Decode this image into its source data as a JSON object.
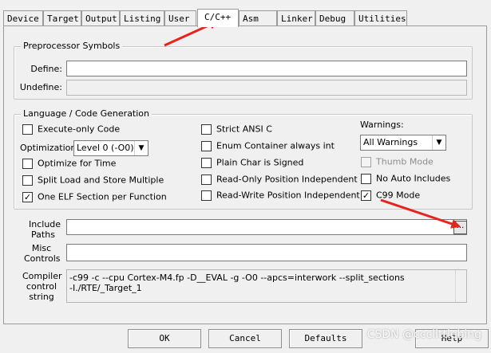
{
  "tabs": [
    {
      "label": "Device"
    },
    {
      "label": "Target"
    },
    {
      "label": "Output"
    },
    {
      "label": "Listing"
    },
    {
      "label": "User"
    },
    {
      "label": "C/C++",
      "active": true
    },
    {
      "label": "Asm"
    },
    {
      "label": "Linker"
    },
    {
      "label": "Debug"
    },
    {
      "label": "Utilities"
    }
  ],
  "preprocessor": {
    "title": "Preprocessor Symbols",
    "define_label": "Define:",
    "define_value": "",
    "undefine_label": "Undefine:",
    "undefine_value": ""
  },
  "language": {
    "title": "Language / Code Generation",
    "execute_only": {
      "label": "Execute-only Code",
      "checked": false
    },
    "optimization_label": "Optimization:",
    "optimization_value": "Level 0 (-O0)",
    "optimize_time": {
      "label": "Optimize for Time",
      "checked": false
    },
    "split_load": {
      "label": "Split Load and Store Multiple",
      "checked": false
    },
    "one_elf": {
      "label": "One ELF Section per Function",
      "checked": true
    },
    "strict_ansi": {
      "label": "Strict ANSI C",
      "checked": false
    },
    "enum_container": {
      "label": "Enum Container always int",
      "checked": false
    },
    "plain_char": {
      "label": "Plain Char is Signed",
      "checked": false
    },
    "ro_pi": {
      "label": "Read-Only Position Independent",
      "checked": false
    },
    "rw_pi": {
      "label": "Read-Write Position Independent",
      "checked": false
    },
    "warnings_label": "Warnings:",
    "warnings_value": "All Warnings",
    "thumb_mode": {
      "label": "Thumb Mode",
      "checked": false,
      "disabled": true
    },
    "no_auto_includes": {
      "label": "No Auto Includes",
      "checked": false
    },
    "c99_mode": {
      "label": "C99 Mode",
      "checked": true
    }
  },
  "include_paths": {
    "label_line1": "Include",
    "label_line2": "Paths",
    "value": "",
    "browse_label": "..."
  },
  "misc_controls": {
    "label_line1": "Misc",
    "label_line2": "Controls",
    "value": ""
  },
  "compiler_control": {
    "label_line1": "Compiler",
    "label_line2": "control",
    "label_line3": "string",
    "line1": "-c99 -c --cpu Cortex-M4.fp -D__EVAL -g -O0 --apcs=interwork --split_sections",
    "line2": "-I./RTE/_Target_1"
  },
  "buttons": {
    "ok": "OK",
    "cancel": "Cancel",
    "defaults": "Defaults",
    "help": "Help"
  },
  "watermark": "CSDN @ccclittlebing",
  "annotation_color": "#e8221c",
  "check_glyph": "✓"
}
